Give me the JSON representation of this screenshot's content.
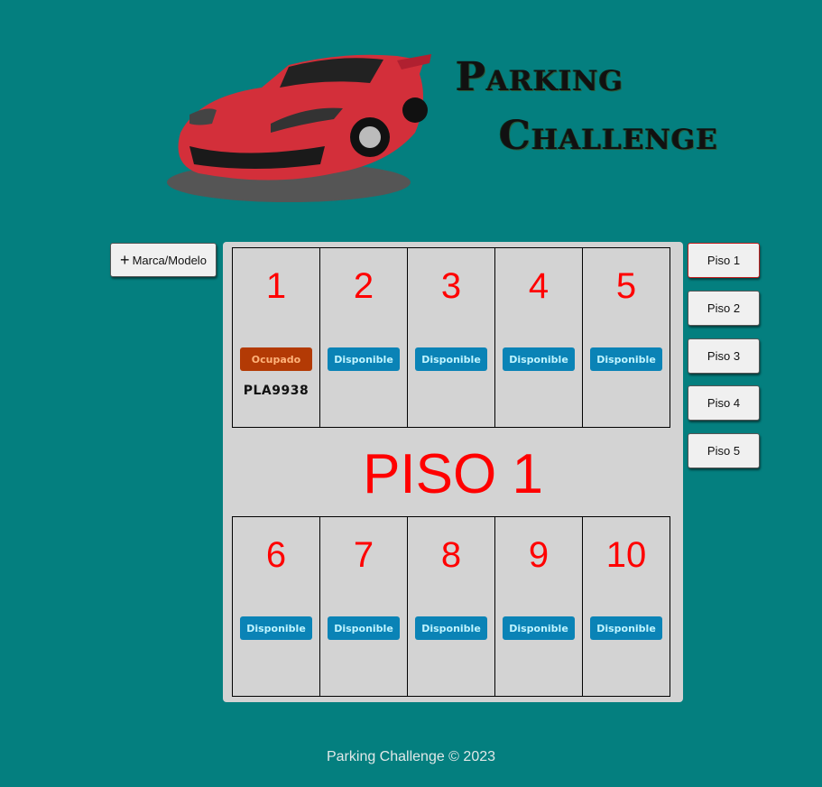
{
  "header": {
    "title_line1": "Parking",
    "title_line2": "Challenge"
  },
  "toolbar": {
    "add_label": "Marca/Modelo",
    "add_icon": "plus-icon"
  },
  "floor": {
    "label": "PISO 1",
    "top_spots": [
      {
        "number": "1",
        "status": "Ocupado",
        "plate": "PLA9938"
      },
      {
        "number": "2",
        "status": "Disponible",
        "plate": ""
      },
      {
        "number": "3",
        "status": "Disponible",
        "plate": ""
      },
      {
        "number": "4",
        "status": "Disponible",
        "plate": ""
      },
      {
        "number": "5",
        "status": "Disponible",
        "plate": ""
      }
    ],
    "bottom_spots": [
      {
        "number": "6",
        "status": "Disponible",
        "plate": ""
      },
      {
        "number": "7",
        "status": "Disponible",
        "plate": ""
      },
      {
        "number": "8",
        "status": "Disponible",
        "plate": ""
      },
      {
        "number": "9",
        "status": "Disponible",
        "plate": ""
      },
      {
        "number": "10",
        "status": "Disponible",
        "plate": ""
      }
    ]
  },
  "floor_buttons": [
    "Piso 1",
    "Piso 2",
    "Piso 3",
    "Piso 4",
    "Piso 5"
  ],
  "footer": {
    "text": "Parking Challenge © 2023"
  },
  "colors": {
    "background": "#047f7f",
    "available": "#0a83b6",
    "occupied": "#b33a05",
    "spot_number": "#ff0000"
  }
}
